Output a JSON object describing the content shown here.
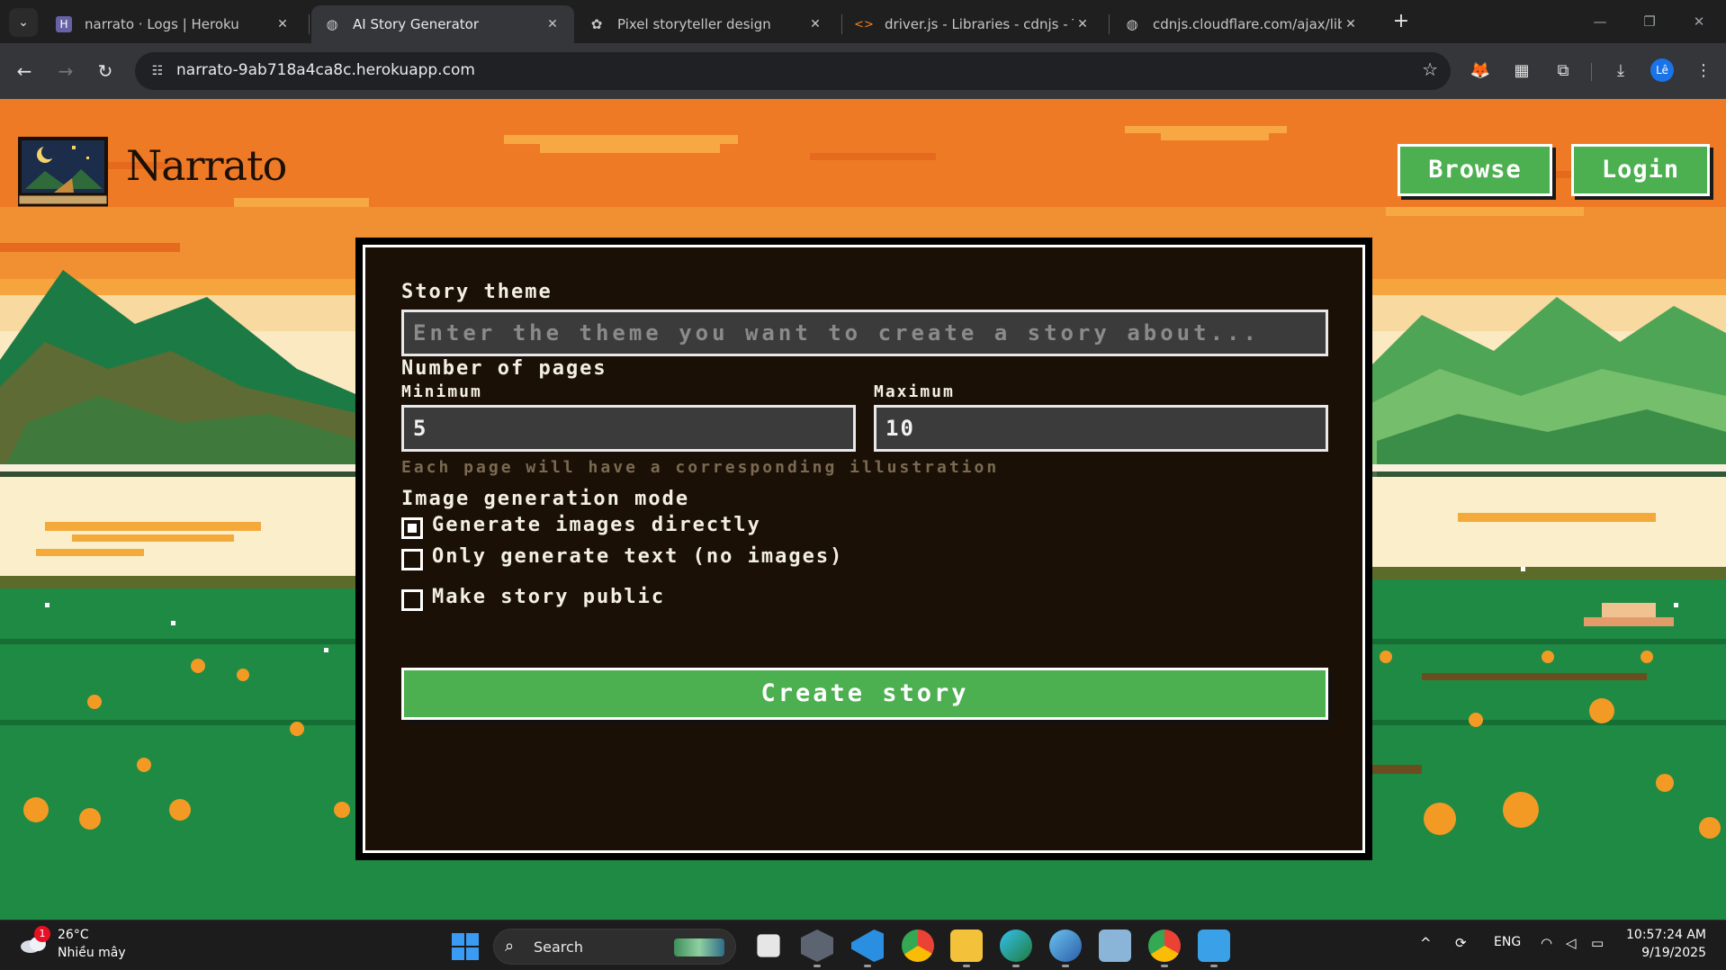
{
  "browser": {
    "tabs": [
      {
        "title": "narrato · Logs | Heroku",
        "favicon": "heroku-icon",
        "active": false
      },
      {
        "title": "AI Story Generator",
        "favicon": "globe-icon",
        "active": true
      },
      {
        "title": "Pixel storyteller design",
        "favicon": "openai-icon",
        "active": false
      },
      {
        "title": "driver.js - Libraries - cdnjs - The",
        "favicon": "code-icon",
        "active": false
      },
      {
        "title": "cdnjs.cloudflare.com/ajax/libs/d",
        "favicon": "globe-icon",
        "active": false
      }
    ],
    "url": "narrato-9ab718a4ca8c.herokuapp.com",
    "profile_initials": "Lê"
  },
  "page": {
    "brand": "Narrato",
    "nav": {
      "browse": "Browse",
      "login": "Login"
    },
    "form": {
      "theme_label": "Story theme",
      "theme_placeholder": "Enter the theme you want to create a story about...",
      "pages_label": "Number of pages",
      "min_label": "Minimum",
      "min_value": "5",
      "max_label": "Maximum",
      "max_value": "10",
      "pages_hint": "Each page will have a corresponding illustration",
      "mode_label": "Image generation mode",
      "mode_options": [
        {
          "label": "Generate images directly",
          "checked": true
        },
        {
          "label": "Only generate text (no images)",
          "checked": false
        }
      ],
      "public_label": "Make story public",
      "public_checked": false,
      "create_label": "Create story"
    },
    "colors": {
      "accent_green": "#4caf50",
      "sky_orange": "#f0852a"
    }
  },
  "taskbar": {
    "weather_temp": "26°C",
    "weather_desc": "Nhiều mây",
    "weather_badge": "1",
    "search_label": "Search",
    "language": "ENG",
    "time": "10:57:24 AM",
    "date": "9/19/2025"
  }
}
